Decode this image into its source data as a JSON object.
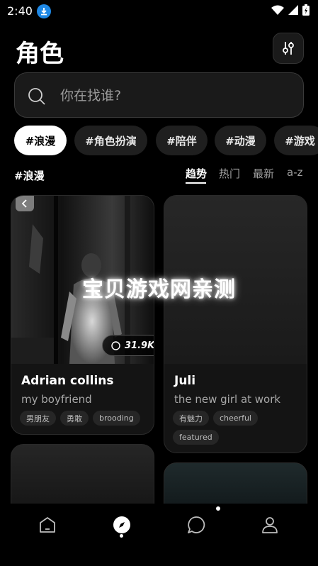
{
  "status_bar": {
    "time": "2:40"
  },
  "header": {
    "title": "角色"
  },
  "search": {
    "placeholder": "你在找谁?"
  },
  "tags": [
    {
      "label": "#浪漫",
      "active": true
    },
    {
      "label": "#角色扮演",
      "active": false
    },
    {
      "label": "#陪伴",
      "active": false
    },
    {
      "label": "#动漫",
      "active": false
    },
    {
      "label": "#游戏",
      "active": false
    }
  ],
  "section": {
    "label": "#浪漫"
  },
  "sort_tabs": [
    {
      "label": "趋势",
      "active": true
    },
    {
      "label": "热门",
      "active": false
    },
    {
      "label": "最新",
      "active": false
    },
    {
      "label": "a-z",
      "active": false
    }
  ],
  "cards": [
    {
      "name": "Adrian collins",
      "subtitle": "my boyfriend",
      "tags": [
        "男朋友",
        "勇敢",
        "brooding"
      ],
      "chat_count": "31.9K"
    },
    {
      "name": "Juli",
      "subtitle": "the new girl at work",
      "tags": [
        "有魅力",
        "cheerful",
        "featured"
      ]
    }
  ],
  "watermark": "宝贝游戏网亲测",
  "bottom_nav": [
    "home-icon",
    "compass-icon",
    "chat-icon",
    "profile-icon"
  ]
}
